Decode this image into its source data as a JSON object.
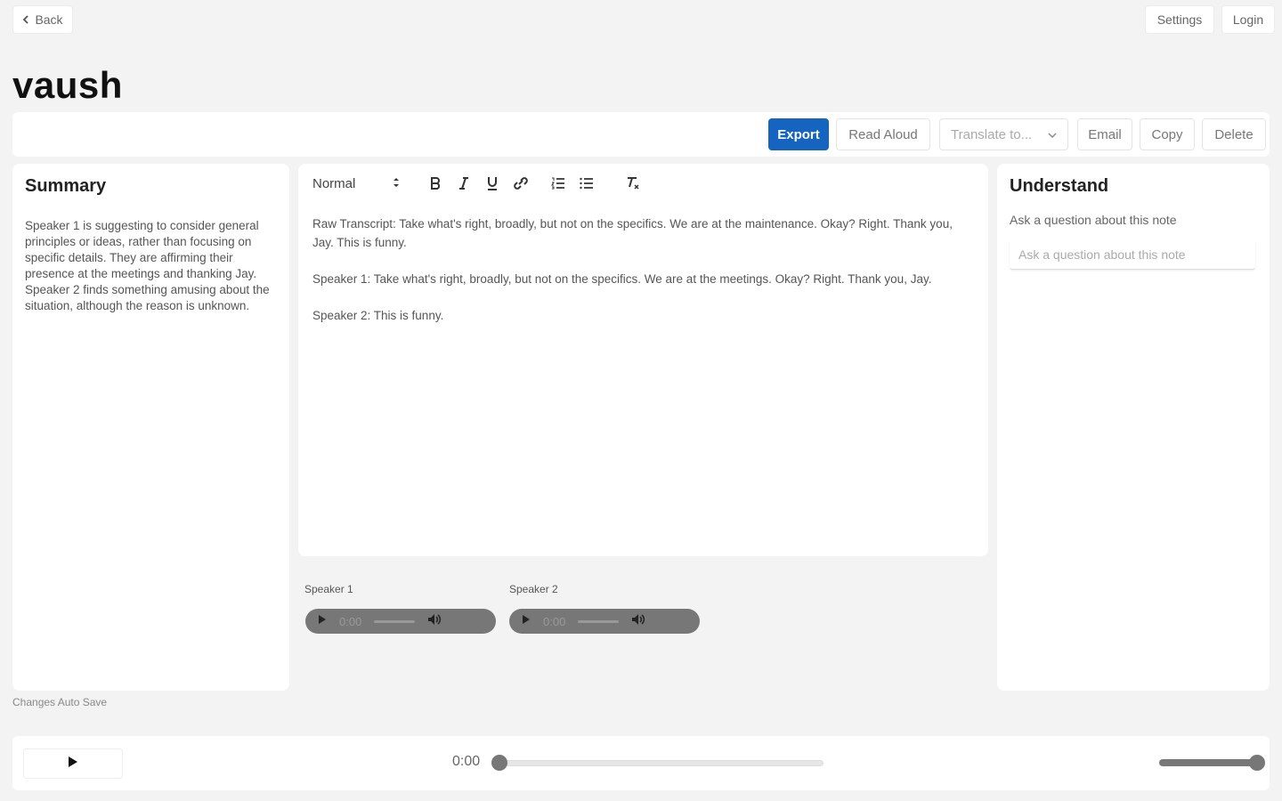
{
  "nav": {
    "back_label": "Back",
    "settings_label": "Settings",
    "login_label": "Login"
  },
  "note": {
    "title": "vaush"
  },
  "toolbar": {
    "export_label": "Export",
    "read_aloud_label": "Read Aloud",
    "translate_placeholder": "Translate to...",
    "email_label": "Email",
    "copy_label": "Copy",
    "delete_label": "Delete"
  },
  "summary": {
    "heading": "Summary",
    "text": "Speaker 1 is suggesting to consider general principles or ideas, rather than focusing on specific details. They are affirming their presence at the meetings and thanking Jay. Speaker 2 finds something amusing about the situation, although the reason is unknown."
  },
  "editor": {
    "format_select": "Normal",
    "paragraphs": [
      "Raw Transcript: Take what's right, broadly, but not on the specifics. We are at the maintenance. Okay? Right. Thank you, Jay. This is funny.",
      "Speaker 1:  Take what's right, broadly, but not on the specifics. We are at the meetings. Okay? Right. Thank you, Jay.",
      "Speaker 2:  This is funny."
    ]
  },
  "understand": {
    "heading": "Understand",
    "subtitle": "Ask a question about this note",
    "input_placeholder": "Ask a question about this note"
  },
  "speakers": [
    {
      "label": "Speaker 1",
      "time": "0:00"
    },
    {
      "label": "Speaker 2",
      "time": "0:00"
    }
  ],
  "footer": {
    "autosave_label": "Changes Auto Save"
  },
  "player": {
    "time": "0:00",
    "seek_progress": 0,
    "volume": 1.0
  },
  "colors": {
    "accent": "#1565c0",
    "control_gray": "#777777"
  }
}
